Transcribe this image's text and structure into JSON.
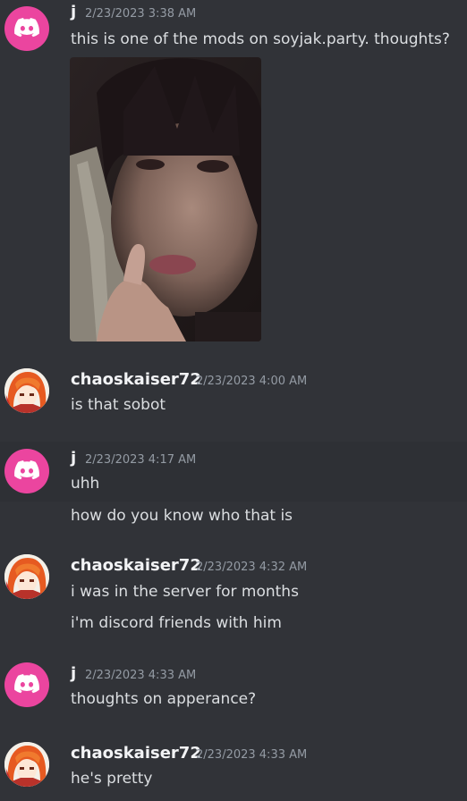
{
  "messages": [
    {
      "author": "j",
      "timestamp": "2/23/2023 3:38 AM",
      "avatar_icon": "discord-logo-icon",
      "lines": [
        "this is one of the mods on soyjak.party. thoughts?"
      ],
      "has_image": true
    },
    {
      "author": "chaoskaiser72",
      "timestamp": "2/23/2023 4:00 AM",
      "avatar_icon": "anime-avatar",
      "lines": [
        "is that sobot"
      ]
    },
    {
      "author": "j",
      "timestamp": "2/23/2023 4:17 AM",
      "avatar_icon": "discord-logo-icon",
      "lines": [
        "uhh",
        "how do you know who that is"
      ]
    },
    {
      "author": "chaoskaiser72",
      "timestamp": "2/23/2023 4:32 AM",
      "avatar_icon": "anime-avatar",
      "lines": [
        "i was in the server for months",
        "i'm discord friends with him"
      ]
    },
    {
      "author": "j",
      "timestamp": "2/23/2023 4:33 AM",
      "avatar_icon": "discord-logo-icon",
      "lines": [
        "thoughts on apperance?"
      ]
    },
    {
      "author": "chaoskaiser72",
      "timestamp": "2/23/2023 4:33 AM",
      "avatar_icon": "anime-avatar",
      "lines": [
        "he's pretty"
      ]
    }
  ],
  "colors": {
    "background": "#313338",
    "highlight": "#2e3035",
    "discord_avatar": "#eb459f",
    "timestamp": "#949ba4",
    "username": "#f2f3f5"
  }
}
